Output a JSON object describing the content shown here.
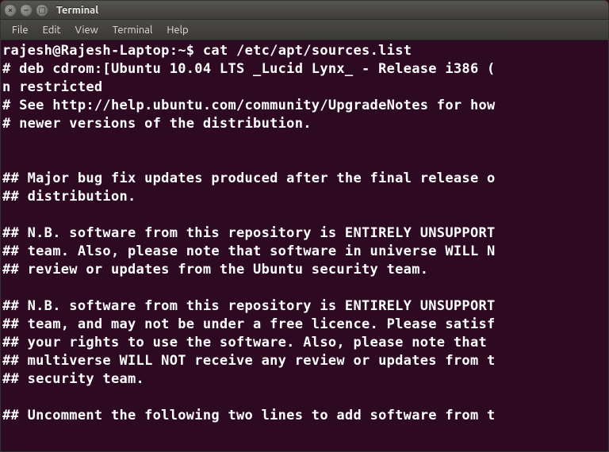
{
  "window": {
    "title": "Terminal"
  },
  "menubar": {
    "file": "File",
    "edit": "Edit",
    "view": "View",
    "terminal": "Terminal",
    "help": "Help"
  },
  "terminal": {
    "prompt_user_host": "rajesh@Rajesh-Laptop",
    "prompt_path": "~",
    "prompt_symbol": "$",
    "command": "cat /etc/apt/sources.list",
    "output_lines": [
      "# deb cdrom:[Ubuntu 10.04 LTS _Lucid Lynx_ - Release i386 (",
      "n restricted",
      "# See http://help.ubuntu.com/community/UpgradeNotes for how",
      "# newer versions of the distribution.",
      "",
      "",
      "## Major bug fix updates produced after the final release o",
      "## distribution.",
      "",
      "## N.B. software from this repository is ENTIRELY UNSUPPORT",
      "## team. Also, please note that software in universe WILL N",
      "## review or updates from the Ubuntu security team.",
      "",
      "## N.B. software from this repository is ENTIRELY UNSUPPORT",
      "## team, and may not be under a free licence. Please satisf",
      "## your rights to use the software. Also, please note that ",
      "## multiverse WILL NOT receive any review or updates from t",
      "## security team.",
      "",
      "## Uncomment the following two lines to add software from t"
    ]
  }
}
